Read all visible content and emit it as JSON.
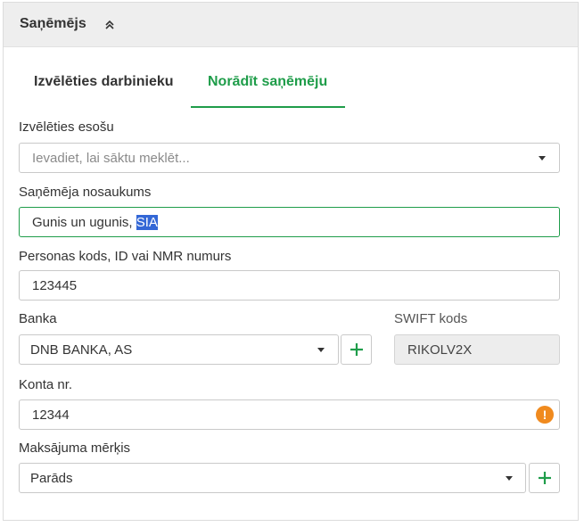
{
  "header": {
    "title": "Saņēmējs"
  },
  "tabs": [
    {
      "label": "Izvēlēties darbinieku",
      "active": false
    },
    {
      "label": "Norādīt saņēmēju",
      "active": true
    }
  ],
  "form": {
    "existing": {
      "label": "Izvēlēties esošu",
      "placeholder": "Ievadiet, lai sāktu meklēt..."
    },
    "name": {
      "label": "Saņēmēja nosaukums",
      "value_prefix": "Gunis un ugunis, ",
      "value_selected": "SIA"
    },
    "personal_code": {
      "label": "Personas kods, ID vai NMR numurs",
      "value": "123445"
    },
    "bank": {
      "label": "Banka",
      "value": "DNB BANKA, AS"
    },
    "swift": {
      "label": "SWIFT kods",
      "value": "RIKOLV2X"
    },
    "account": {
      "label": "Konta nr.",
      "value": "12344",
      "warning_symbol": "!"
    },
    "purpose": {
      "label": "Maksājuma mērķis",
      "value": "Parāds"
    }
  },
  "colors": {
    "accent": "#1f9d4a",
    "warning": "#f08a1e",
    "selection": "#3367d6",
    "header_bg": "#eeeeee"
  },
  "icons": {
    "collapse": "chevron-double-up-icon",
    "add": "plus-icon",
    "dropdown": "caret-down-icon",
    "warning": "exclamation-circle-icon"
  }
}
